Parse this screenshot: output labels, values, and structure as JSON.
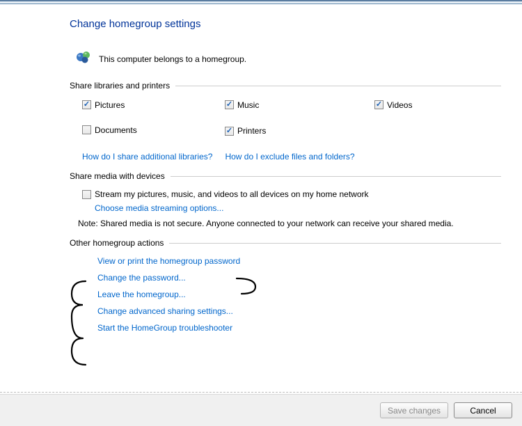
{
  "title": "Change homegroup settings",
  "status": "This computer belongs to a homegroup.",
  "sections": {
    "share_libs": "Share libraries and printers",
    "share_media": "Share media with devices",
    "other_actions": "Other homegroup actions"
  },
  "checkboxes": {
    "pictures": {
      "label": "Pictures",
      "checked": true
    },
    "music": {
      "label": "Music",
      "checked": true
    },
    "videos": {
      "label": "Videos",
      "checked": true
    },
    "documents": {
      "label": "Documents",
      "checked": false
    },
    "printers": {
      "label": "Printers",
      "checked": true
    },
    "stream": {
      "label": "Stream my pictures, music, and videos to all devices on my home network",
      "checked": false
    }
  },
  "links": {
    "share_additional": "How do I share additional libraries?",
    "exclude": "How do I exclude files and folders?",
    "streaming_options": "Choose media streaming options...",
    "view_password": "View or print the homegroup password",
    "change_password": "Change the password...",
    "leave": "Leave the homegroup...",
    "advanced": "Change advanced sharing settings...",
    "troubleshooter": "Start the HomeGroup troubleshooter"
  },
  "note": "Note: Shared media is not secure. Anyone connected to your network can receive your shared media.",
  "buttons": {
    "save": "Save changes",
    "cancel": "Cancel"
  }
}
